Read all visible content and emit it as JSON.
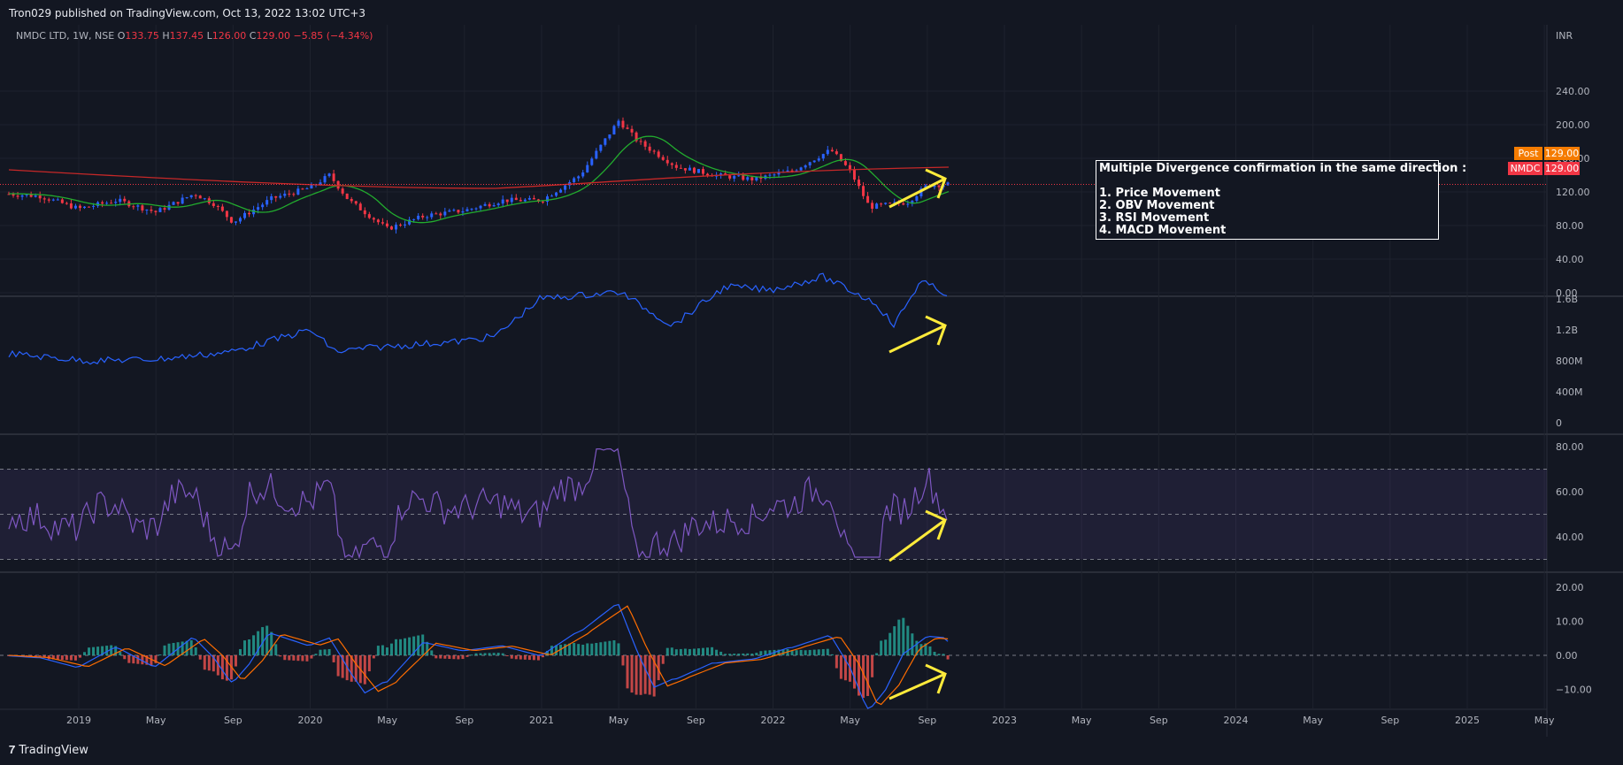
{
  "header": {
    "published": "Tron029 published on TradingView.com, Oct 13, 2022 13:02 UTC+3"
  },
  "legend": {
    "symbol": "NMDC LTD, 1W, NSE",
    "o_label": "O",
    "o": "133.75",
    "h_label": "H",
    "h": "137.45",
    "l_label": "L",
    "l": "126.00",
    "c_label": "C",
    "c": "129.00",
    "change": "−5.85 (−4.34%)"
  },
  "price_axis": {
    "currency": "INR",
    "ticks": [
      "240.00",
      "200.00",
      "160.00",
      "120.00",
      "80.00",
      "40.00",
      "0.00"
    ]
  },
  "tags": {
    "post_label": "Post",
    "post_value": "129.00",
    "symbol_label": "NMDC",
    "symbol_value": "129.00"
  },
  "obv_axis": {
    "ticks": [
      "1.6B",
      "1.2B",
      "800M",
      "400M",
      "0"
    ]
  },
  "rsi_axis": {
    "ticks": [
      "80.00",
      "60.00",
      "40.00"
    ]
  },
  "macd_axis": {
    "ticks": [
      "20.00",
      "10.00",
      "0.00",
      "−10.00"
    ]
  },
  "time_axis": {
    "labels": [
      "2019",
      "May",
      "Sep",
      "2020",
      "May",
      "Sep",
      "2021",
      "May",
      "Sep",
      "2022",
      "May",
      "Sep",
      "2023",
      "May",
      "Sep",
      "2024",
      "May",
      "Sep",
      "2025",
      "May"
    ]
  },
  "note": {
    "lines": [
      "Multiple Divergence confirmation in the same direction :",
      "",
      "1. Price Movement",
      "2. OBV  Movement",
      "3. RSI Movement",
      "4. MACD Movement"
    ]
  },
  "footer": {
    "brand": "TradingView"
  },
  "colors": {
    "background": "#131722",
    "up": "#2962ff",
    "down": "#f23645",
    "ema_short": "#22ab2e",
    "ema_long": "#c62828",
    "obv": "#2962ff",
    "rsi": "#7e57c2",
    "macd": "#2962ff",
    "signal": "#ff6d00",
    "arrow": "#ffeb3b"
  },
  "chart_data": [
    {
      "type": "line",
      "name": "price",
      "x": [
        "2018-09",
        "2018-11",
        "2019-01",
        "2019-03",
        "2019-05",
        "2019-07",
        "2019-08",
        "2019-09",
        "2019-11",
        "2020-01",
        "2020-02",
        "2020-03",
        "2020-05",
        "2020-07",
        "2020-09",
        "2020-11",
        "2021-01",
        "2021-03",
        "2021-05",
        "2021-06",
        "2021-08",
        "2021-10",
        "2021-12",
        "2022-02",
        "2022-04",
        "2022-05",
        "2022-06",
        "2022-08",
        "2022-09",
        "2022-10"
      ],
      "y": [
        118,
        115,
        100,
        110,
        96,
        118,
        106,
        84,
        112,
        125,
        140,
        110,
        76,
        92,
        98,
        110,
        110,
        140,
        205,
        180,
        150,
        140,
        135,
        145,
        170,
        145,
        102,
        108,
        128,
        129
      ],
      "ylim": [
        0,
        250
      ]
    },
    {
      "type": "line",
      "name": "OBV",
      "ylim": [
        0,
        1600000000
      ]
    },
    {
      "type": "line",
      "name": "RSI",
      "ylim": [
        25,
        85
      ]
    },
    {
      "type": "bar",
      "name": "MACD",
      "ylim": [
        -15,
        22
      ]
    }
  ]
}
